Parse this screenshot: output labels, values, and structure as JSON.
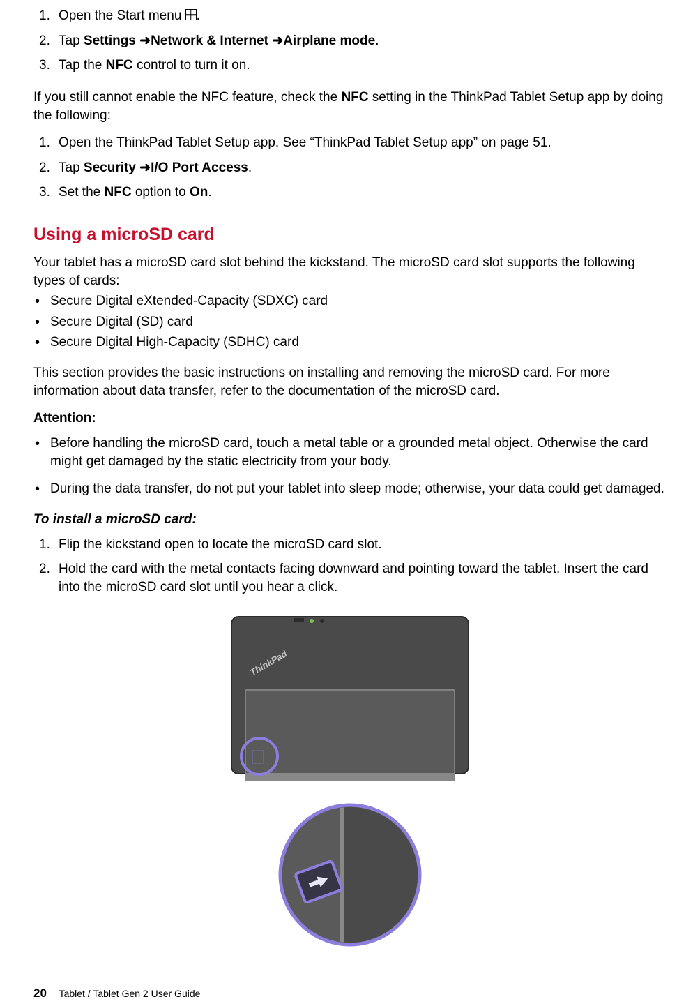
{
  "steps1": {
    "s1_pre": "Open the Start menu ",
    "s1_post": ".",
    "s2_pre": "Tap ",
    "s2_b1": "Settings",
    "s2_b2": "Network & Internet",
    "s2_b3": "Airplane mode",
    "s2_post": ".",
    "s3_pre": "Tap the ",
    "s3_b": "NFC",
    "s3_post": " control to turn it on."
  },
  "nfc_check_pre": "If you still cannot enable the NFC feature, check the ",
  "nfc_check_b": "NFC",
  "nfc_check_post": " setting in the ThinkPad Tablet Setup app by doing the following:",
  "steps2": {
    "s1": "Open the ThinkPad Tablet Setup app. See “ThinkPad Tablet Setup app” on page 51.",
    "s2_pre": "Tap ",
    "s2_b1": "Security",
    "s2_b2": "I/O Port Access",
    "s2_post": ".",
    "s3_pre": "Set the ",
    "s3_b1": "NFC",
    "s3_mid": " option to ",
    "s3_b2": "On",
    "s3_post": "."
  },
  "section_title": "Using a microSD card",
  "sd_intro": "Your tablet has a microSD card slot behind the kickstand. The microSD card slot supports the following types of cards:",
  "sd_list": {
    "i1": "Secure Digital eXtended-Capacity (SDXC) card",
    "i2": "Secure Digital (SD) card",
    "i3": "Secure Digital High-Capacity (SDHC) card"
  },
  "sd_basic": "This section provides the basic instructions on installing and removing the microSD card. For more information about data transfer, refer to the documentation of the microSD card.",
  "attention_label": "Attention:",
  "attention": {
    "a1": "Before handling the microSD card, touch a metal table or a grounded metal object. Otherwise the card might get damaged by the static electricity from your body.",
    "a2": "During the data transfer, do not put your tablet into sleep mode; otherwise, your data could get damaged."
  },
  "install_title": "To install a microSD card:",
  "install_steps": {
    "s1": "Flip the kickstand open to locate the microSD card slot.",
    "s2": "Hold the card with the metal contacts facing downward and pointing toward the tablet. Insert the card into the microSD card slot until you hear a click."
  },
  "footer": {
    "page": "20",
    "title": "Tablet / Tablet Gen 2 User Guide"
  },
  "icons": {
    "start": "start-icon"
  },
  "thinkpad_label": "ThinkPad"
}
